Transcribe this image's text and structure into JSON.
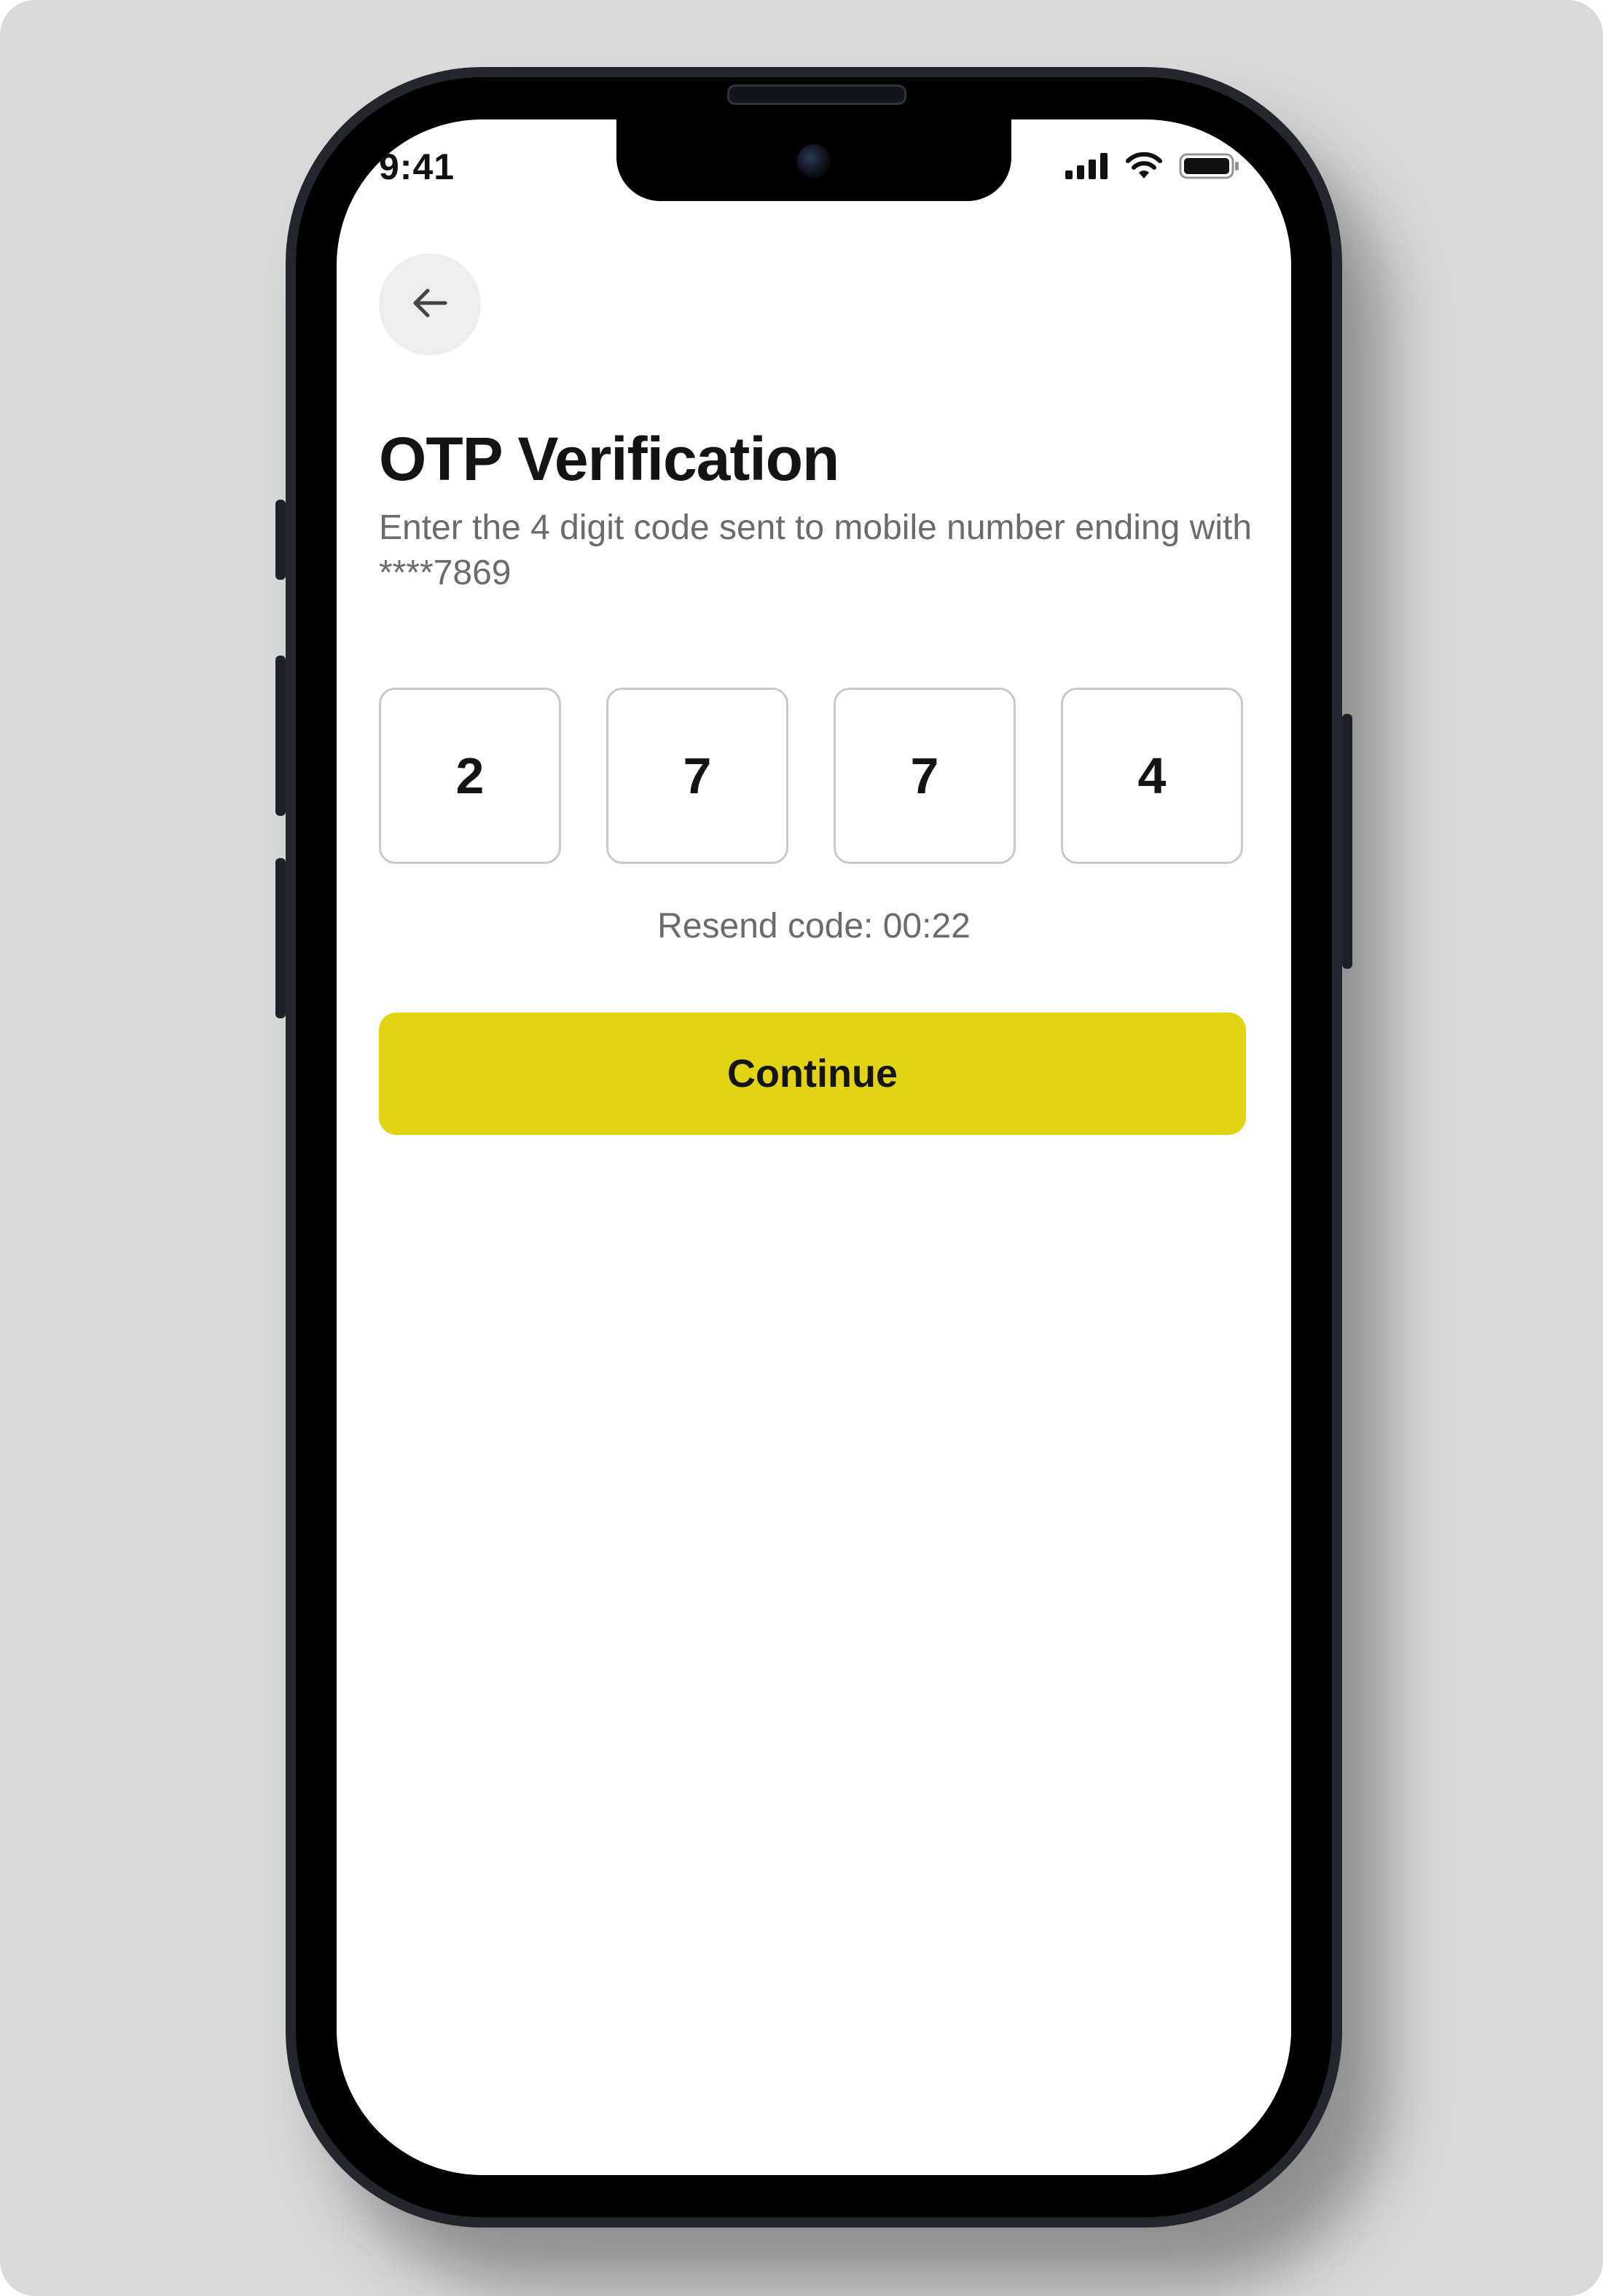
{
  "status_bar": {
    "time": "9:41",
    "icons": [
      "cellular-signal-icon",
      "wifi-icon",
      "battery-icon"
    ]
  },
  "header": {
    "back_icon": "arrow-left-icon",
    "title": "OTP Verification",
    "subtitle": "Enter the 4 digit code sent to mobile number ending with ****7869"
  },
  "otp": {
    "digits": [
      "2",
      "7",
      "7",
      "4"
    ]
  },
  "resend": {
    "text": "Resend code: 00:22"
  },
  "actions": {
    "continue_label": "Continue"
  },
  "colors": {
    "accent": "#e2d314",
    "background": "#dadada",
    "text_primary": "#141414",
    "text_secondary": "#6b6b6b",
    "box_border": "#c9c9c9"
  }
}
